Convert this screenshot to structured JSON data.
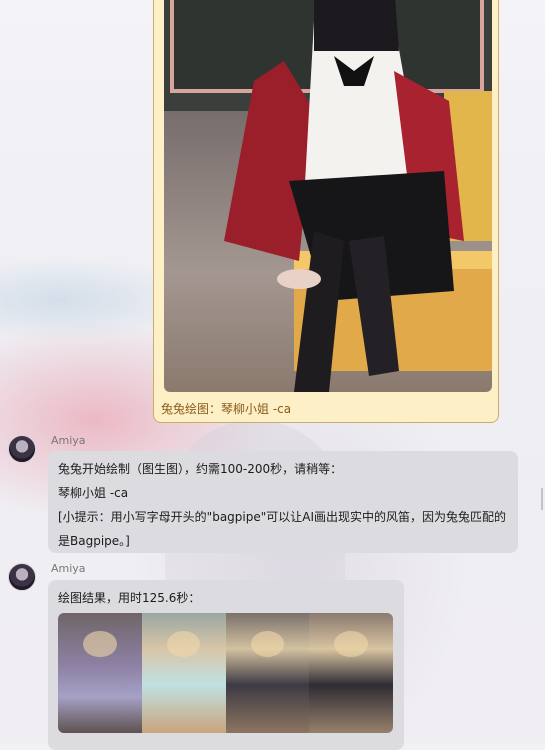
{
  "image_message": {
    "caption": "兔兔绘图：琴柳小姐 -ca"
  },
  "messages": [
    {
      "sender": "Amiya",
      "lines": [
        "兔兔开始绘制（图生图），约需100-200秒，请稍等：",
        "琴柳小姐 -ca",
        "[小提示：用小写字母开头的\"bagpipe\"可以让AI画出现实中的风笛，因为兔兔匹配的",
        "是Bagpipe。]"
      ]
    },
    {
      "sender": "Amiya",
      "text": "绘图结果，用时125.6秒："
    }
  ],
  "colors": {
    "image_bubble_bg": "#fdf0c7",
    "image_bubble_border": "#c9ab6b",
    "caption_text": "#8a5a17",
    "text_bubble_bg": "#dcdbe0"
  }
}
